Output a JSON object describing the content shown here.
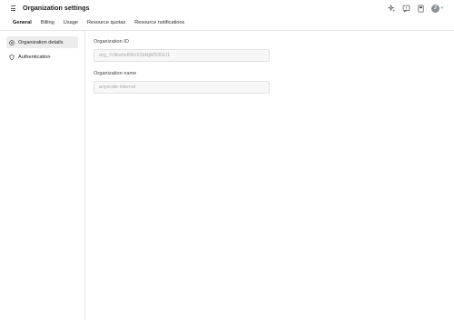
{
  "header": {
    "title": "Organization settings",
    "icons": [
      "sparkle-icon",
      "feedback-icon",
      "docs-icon"
    ],
    "avatar_initial": "J"
  },
  "tabs": [
    {
      "label": "General",
      "active": true
    },
    {
      "label": "Billing",
      "active": false
    },
    {
      "label": "Usage",
      "active": false
    },
    {
      "label": "Resource quotas",
      "active": false
    },
    {
      "label": "Resource notifications",
      "active": false
    }
  ],
  "sidebar": {
    "items": [
      {
        "label": "Organization details",
        "icon": "info-circle-icon",
        "active": true
      },
      {
        "label": "Authentication",
        "icon": "shield-icon",
        "active": false
      }
    ]
  },
  "form": {
    "org_id": {
      "label": "Organization ID",
      "value": "org_7c9kahn8WcX3bNjWS3GU1"
    },
    "org_name": {
      "label": "Organization name",
      "value": "anyscale-internal"
    }
  },
  "colors": {
    "active_tab_underline": "#1a1a1a",
    "active_sidebar_bg": "#ececec",
    "input_bg": "#f7f7f7",
    "border": "#e6e6e6"
  }
}
